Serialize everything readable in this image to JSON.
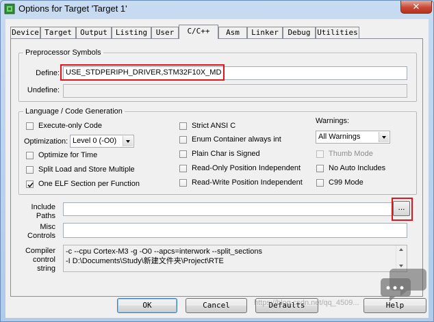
{
  "window": {
    "title": "Options for Target 'Target 1'",
    "close_glyph": "✕"
  },
  "tabs": [
    {
      "label": "Device",
      "active": false
    },
    {
      "label": "Target",
      "active": false
    },
    {
      "label": "Output",
      "active": false
    },
    {
      "label": "Listing",
      "active": false
    },
    {
      "label": "User",
      "active": false
    },
    {
      "label": "C/C++",
      "active": true
    },
    {
      "label": "Asm",
      "active": false
    },
    {
      "label": "Linker",
      "active": false
    },
    {
      "label": "Debug",
      "active": false
    },
    {
      "label": "Utilities",
      "active": false
    }
  ],
  "preprocessor": {
    "title": "Preprocessor Symbols",
    "define_label": "Define:",
    "define_value": "USE_STDPERIPH_DRIVER,STM32F10X_MD",
    "undefine_label": "Undefine:",
    "undefine_value": ""
  },
  "language": {
    "title": "Language / Code Generation",
    "execute_only": {
      "label": "Execute-only Code",
      "checked": false
    },
    "optimization_label": "Optimization:",
    "optimization_value": "Level 0 (-O0)",
    "optimize_time": {
      "label": "Optimize for Time",
      "checked": false
    },
    "split_load": {
      "label": "Split Load and Store Multiple",
      "checked": false
    },
    "one_elf": {
      "label": "One ELF Section per Function",
      "checked": true
    },
    "strict_ansi": {
      "label": "Strict ANSI C",
      "checked": false
    },
    "enum_container": {
      "label": "Enum Container always int",
      "checked": false
    },
    "plain_char": {
      "label": "Plain Char is Signed",
      "checked": false
    },
    "readonly_pi": {
      "label": "Read-Only Position Independent",
      "checked": false
    },
    "readwrite_pi": {
      "label": "Read-Write Position Independent",
      "checked": false
    },
    "warnings_label": "Warnings:",
    "warnings_value": "All Warnings",
    "thumb_mode": {
      "label": "Thumb Mode",
      "checked": false,
      "disabled": true
    },
    "no_auto_includes": {
      "label": "No Auto Includes",
      "checked": false
    },
    "c99_mode": {
      "label": "C99 Mode",
      "checked": false
    }
  },
  "paths": {
    "include_label": "Include\nPaths",
    "include_value": "",
    "browse_label": "...",
    "misc_label": "Misc\nControls",
    "misc_value": "",
    "compiler_label": "Compiler\ncontrol\nstring",
    "compiler_value": "-c --cpu Cortex-M3 -g -O0 --apcs=interwork --split_sections\n-I D:\\Documents\\Study\\新建文件夹\\Project\\RTE"
  },
  "buttons": {
    "ok": "OK",
    "cancel": "Cancel",
    "defaults": "Defaults",
    "help": "Help"
  },
  "watermark": "https://blog.csdn.net/qq_4509..."
}
